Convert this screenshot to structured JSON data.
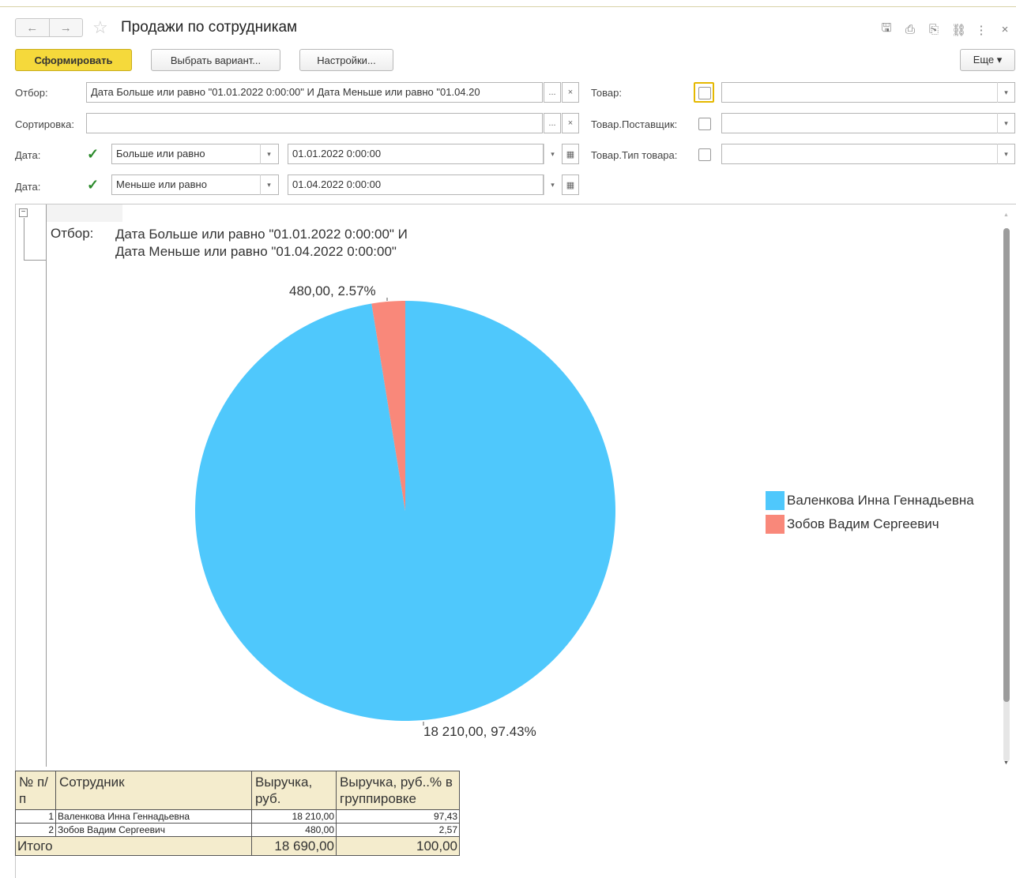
{
  "window": {
    "title": "Продажи по сотрудникам",
    "nav_back": "←",
    "nav_forward": "→",
    "favorite_star": "☆",
    "icons": [
      "save-icon",
      "print-icon",
      "preview-icon",
      "link-icon",
      "more-vertical-icon",
      "close-icon"
    ],
    "icon_glyphs": {
      "save": "🖫",
      "print": "⎙",
      "preview": "⎘",
      "link": "⛓",
      "more": "⋮",
      "close": "×"
    }
  },
  "toolbar": {
    "generate_label": "Сформировать",
    "choose_variant_label": "Выбрать вариант...",
    "settings_label": "Настройки...",
    "more_label": "Еще ▾"
  },
  "filters": {
    "otbor_label": "Отбор:",
    "otbor_value": "Дата Больше или равно \"01.01.2022 0:00:00\" И Дата Меньше или равно \"01.04.20",
    "sort_label": "Сортировка:",
    "sort_value": "",
    "dots": "...",
    "clear": "×",
    "date1_label": "Дата:",
    "date1_checked": true,
    "date1_condition": "Больше или равно",
    "date1_value": "01.01.2022  0:00:00",
    "date2_label": "Дата:",
    "date2_checked": true,
    "date2_condition": "Меньше или равно",
    "date2_value": "01.04.2022  0:00:00",
    "product_label": "Товар:",
    "product_supplier_label": "Товар.Поставщик:",
    "product_type_label": "Товар.Тип товара:",
    "check_glyph": "✓",
    "dd_arrow": "▾",
    "calendar_glyph": "▦"
  },
  "report": {
    "collapse_glyph": "−",
    "filter_label": "Отбор:",
    "filter_line1": "Дата Больше или равно \"01.01.2022 0:00:00\" И",
    "filter_line2": "Дата Меньше или равно \"01.04.2022 0:00:00\""
  },
  "chart_data": {
    "type": "pie",
    "series": [
      {
        "name": "Валенкова Инна Геннадьевна",
        "value": 18210.0,
        "percent": 97.43,
        "label": "18 210,00, 97.43%",
        "color": "#4fc8fc"
      },
      {
        "name": "Зобов Вадим Сергеевич",
        "value": 480.0,
        "percent": 2.57,
        "label": "480,00, 2.57%",
        "color": "#f9887a"
      }
    ],
    "legend_position": "right"
  },
  "table": {
    "headers": [
      "№ п/п",
      "Сотрудник",
      "Выручка, руб.",
      "Выручка, руб..% в группировке"
    ],
    "rows": [
      {
        "n": "1",
        "name": "Валенкова Инна Геннадьевна",
        "revenue": "18 210,00",
        "pct": "97,43"
      },
      {
        "n": "2",
        "name": "Зобов Вадим Сергеевич",
        "revenue": "480,00",
        "pct": "2,57"
      }
    ],
    "total": {
      "label": "Итого",
      "revenue": "18 690,00",
      "pct": "100,00"
    }
  }
}
